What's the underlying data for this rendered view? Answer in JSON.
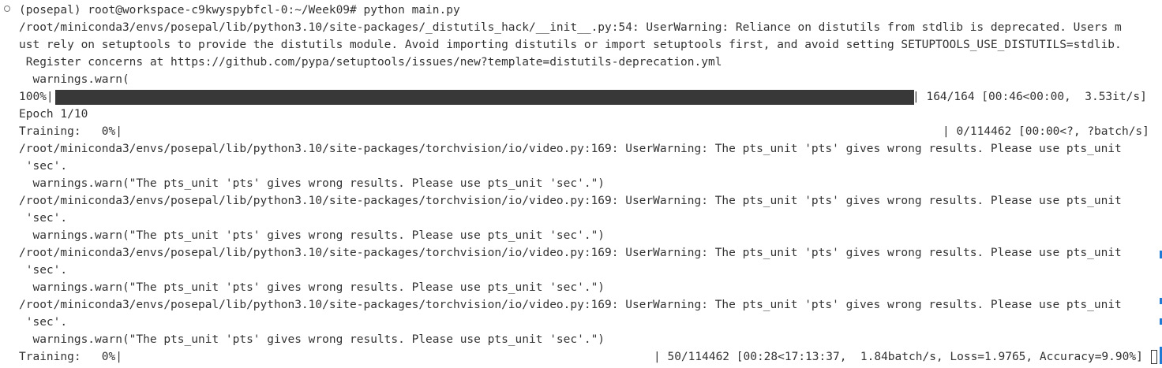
{
  "terminal": {
    "prompt": "(posepal) root@workspace-c9kwyspybfcl-0:~/Week09# python main.py",
    "distutils_warning": [
      "/root/miniconda3/envs/posepal/lib/python3.10/site-packages/_distutils_hack/__init__.py:54: UserWarning: Reliance on distutils from stdlib is deprecated. Users m",
      "ust rely on setuptools to provide the distutils module. Avoid importing distutils or import setuptools first, and avoid setting SETUPTOOLS_USE_DISTUTILS=stdlib.",
      " Register concerns at https://github.com/pypa/setuptools/issues/new?template=distutils-deprecation.yml",
      "  warnings.warn("
    ],
    "progress": {
      "label": "100%|",
      "fraction": 1.0,
      "stats": "| 164/164 [00:46<00:00,  3.53it/s]"
    },
    "epoch": "Epoch 1/10",
    "training_start": {
      "label": "Training:   0%|",
      "stats": "| 0/114462 [00:00<?, ?batch/s]"
    },
    "torchvision_warning": {
      "line1": "/root/miniconda3/envs/posepal/lib/python3.10/site-packages/torchvision/io/video.py:169: UserWarning: The pts_unit 'pts' gives wrong results. Please use pts_unit",
      "line2": " 'sec'.",
      "line3": "  warnings.warn(\"The pts_unit 'pts' gives wrong results. Please use pts_unit 'sec'.\")"
    },
    "training_current": {
      "label": "Training:   0%|",
      "stats": "| 50/114462 [00:28<17:13:37,  1.84batch/s, Loss=1.9765, Accuracy=9.90%]"
    }
  },
  "colors": {
    "background": "#ffffff",
    "text": "#333333",
    "bar": "#383838",
    "scroll_marker": "#1f7ad6"
  }
}
